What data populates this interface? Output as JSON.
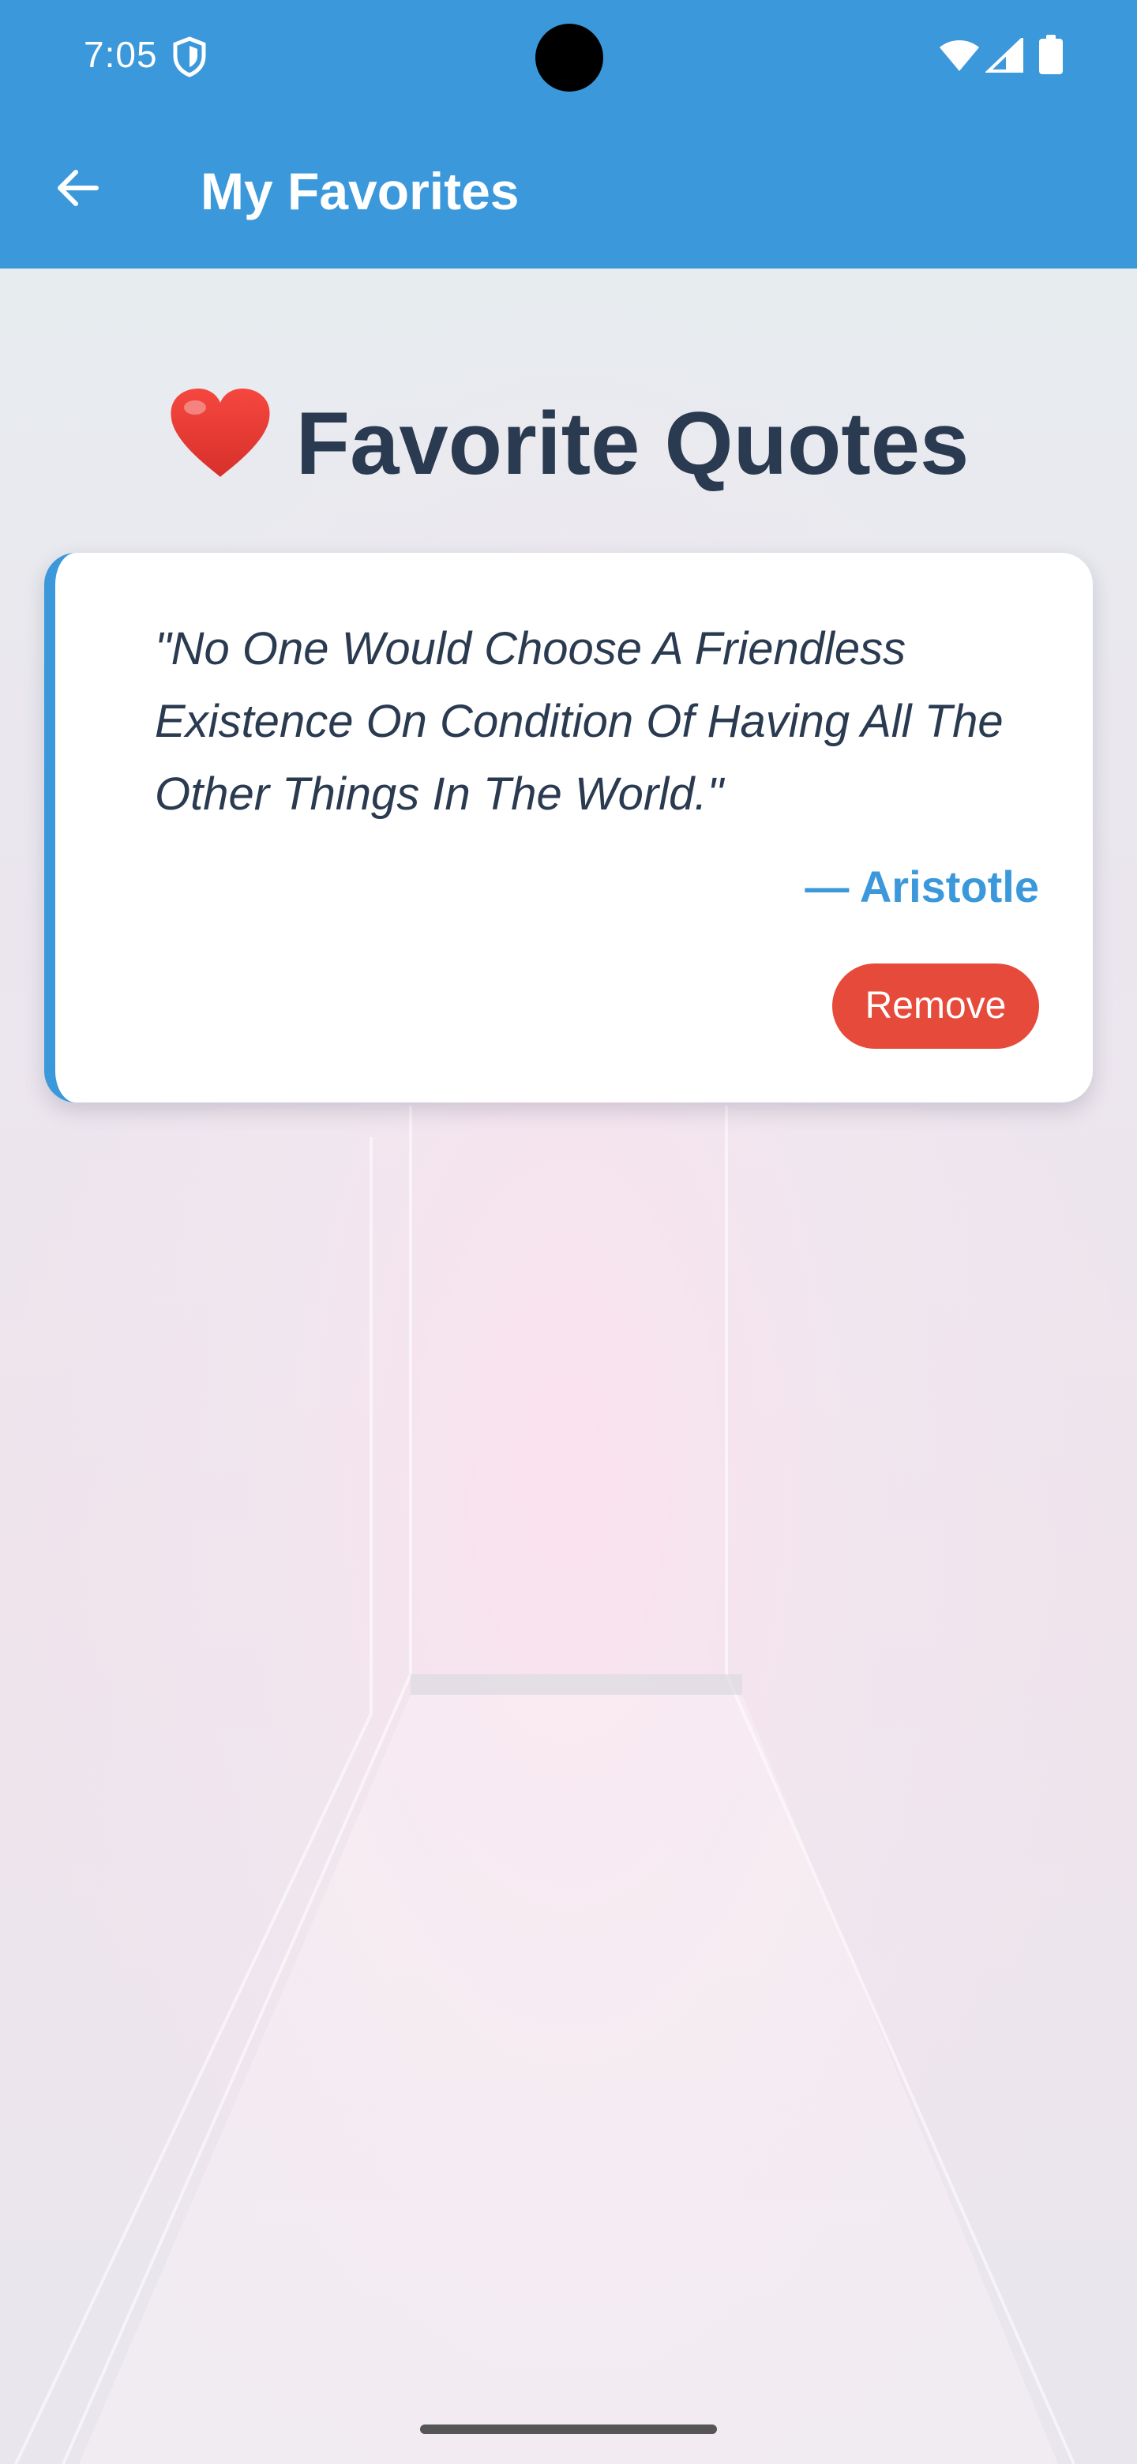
{
  "status_bar": {
    "time": "7:05",
    "icons": [
      "shield-icon",
      "wifi-icon",
      "signal-icon",
      "battery-icon"
    ]
  },
  "app_bar": {
    "title": "My Favorites",
    "back_icon": "arrow-left-icon"
  },
  "heading": {
    "icon": "heart-icon",
    "text": "Favorite Quotes"
  },
  "favorites": [
    {
      "quote": "\"No One Would Choose A Friendless Existence On Condition Of Having All The Other Things In The World.\"",
      "author": "— Aristotle",
      "remove_label": "Remove"
    }
  ],
  "colors": {
    "primary": "#3a98db",
    "danger": "#e64a3b",
    "heading_text": "#2a3a50"
  }
}
